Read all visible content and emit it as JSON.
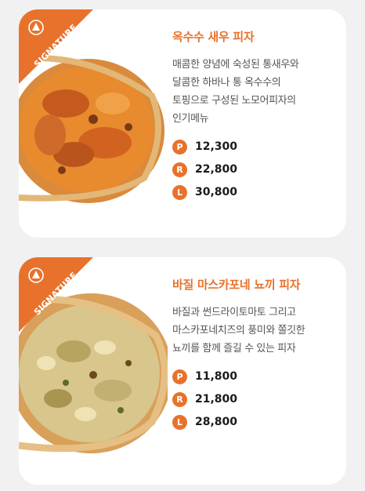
{
  "menu": [
    {
      "ribbon": "SIGNATURE",
      "title": "옥수수 새우 피자",
      "description": [
        "매콤한 양념에 숙성된 통새우와",
        "달콤한 하바나 통 옥수수의",
        "토핑으로 구성된 노모어피자의",
        "인기메뉴"
      ],
      "prices": [
        {
          "size": "P",
          "price": "12,300"
        },
        {
          "size": "R",
          "price": "22,800"
        },
        {
          "size": "L",
          "price": "30,800"
        }
      ]
    },
    {
      "ribbon": "SIGNATURE",
      "title": "바질 마스카포네 뇨끼 피자",
      "description": [
        "바질과 썬드라이토마토 그리고",
        "마스카포네치즈의 풍미와 쫄깃한",
        "뇨끼를 함께 즐길 수 있는 피자"
      ],
      "prices": [
        {
          "size": "P",
          "price": "11,800"
        },
        {
          "size": "R",
          "price": "21,800"
        },
        {
          "size": "L",
          "price": "28,800"
        }
      ]
    }
  ],
  "colors": {
    "accent": "#e8722c",
    "background": "#f1f1f1",
    "card": "#ffffff"
  },
  "icons": [
    "signature-logo-icon",
    "size-badge-icon"
  ]
}
